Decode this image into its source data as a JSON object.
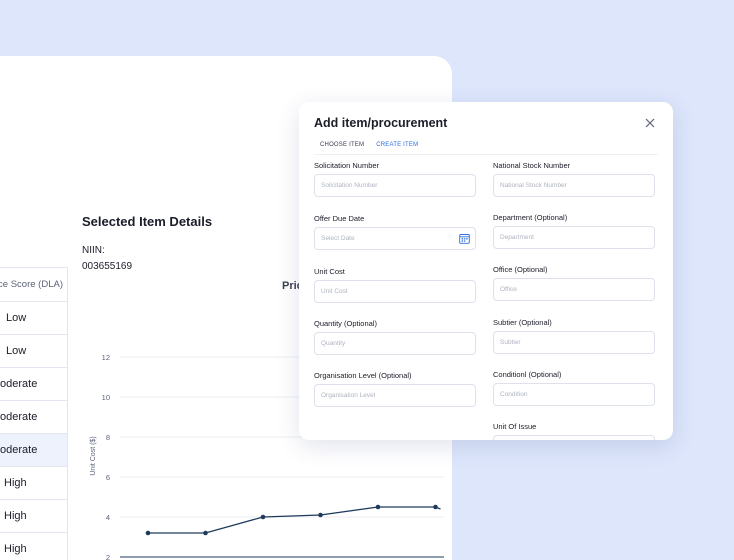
{
  "score_table": {
    "header": "nce Score (DLA)",
    "rows": [
      "Low",
      "Low",
      "oderate",
      "oderate",
      "oderate",
      "High",
      "High",
      "High"
    ],
    "selected_index": 4
  },
  "details": {
    "title": "Selected Item Details",
    "niin_label": "NIIN:",
    "niin_value": "003655169",
    "chart_title_partial": "Pric"
  },
  "chart_data": {
    "type": "line",
    "title": "Pric",
    "ylabel": "Unit Cost ($)",
    "y_ticks": [
      2,
      4,
      6,
      8,
      10,
      12
    ],
    "ylim": [
      2,
      12
    ],
    "series": [
      {
        "values": [
          3.2,
          3.2,
          4.0,
          4.1,
          4.5,
          4.5
        ]
      }
    ],
    "grid": true
  },
  "modal": {
    "title": "Add item/procurement",
    "tabs": [
      {
        "label": "CHOOSE ITEM",
        "active": false
      },
      {
        "label": "CREATE ITEM",
        "active": true
      }
    ],
    "left_fields": [
      {
        "label": "Solicitation Number",
        "placeholder": "Solicitation Number"
      },
      {
        "label": "Offer Due Date",
        "placeholder": "Select Date"
      },
      {
        "label": "Unit Cost",
        "placeholder": "Unit Cost"
      },
      {
        "label": "Quantity (Optional)",
        "placeholder": "Quantity"
      },
      {
        "label": "Organisation Level (Optional)",
        "placeholder": "Organisation Level"
      }
    ],
    "right_fields": [
      {
        "label": "National Stock Number",
        "placeholder": "National Stock Number"
      },
      {
        "label": "Department (Optional)",
        "placeholder": "Department"
      },
      {
        "label": "Office (Optional)",
        "placeholder": "Office"
      },
      {
        "label": "Subtier (Optional)",
        "placeholder": "Subtier"
      },
      {
        "label": "Conditionl (Optional)",
        "placeholder": "Condition"
      },
      {
        "label": "Unit Of Issue",
        "placeholder": ""
      }
    ]
  },
  "colors": {
    "background": "#dde6fb",
    "accent": "#2e6ce6",
    "line": "#1e3a5c"
  }
}
